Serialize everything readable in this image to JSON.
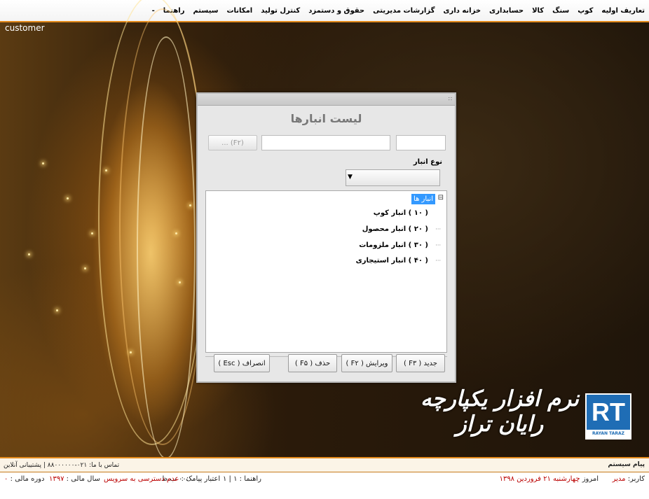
{
  "menubar": {
    "items": [
      "تعاریف اولیه",
      "کوپ",
      "سنگ",
      "کالا",
      "حسابداری",
      "خزانه داری",
      "گزارشات مدیریتی",
      "حقوق و دستمزد",
      "کنترل تولید",
      "امکانات",
      "سیستم",
      "راهنما",
      "-"
    ]
  },
  "desktop": {
    "label": "customer",
    "brand_text": "نرم افزار یکپارچه رایان تراز",
    "logo_mark": "RT",
    "logo_caption": "RAYAN TARAZ"
  },
  "dialog": {
    "title": "لیست انبارها",
    "search_placeholder_left": "",
    "search_placeholder_right": "",
    "f2_button": "(F۲) ...",
    "type_label": "نوع انبار",
    "type_value": "",
    "tree": {
      "root": "انبار ها",
      "items": [
        "( ۱۰ ) انبار کوپ",
        "( ۲۰ ) انبار محصول",
        "( ۳۰ ) انبار ملزومات",
        "( ۴۰ ) انبار استیجاری"
      ]
    },
    "buttons": {
      "new": "جدید ( F۳ )",
      "edit": "ویرایش ( F۲ )",
      "delete": "حذف ( F۵ )",
      "cancel": "انصراف ( Esc )"
    }
  },
  "status": {
    "line1_left": "تماس با ما: ۰۲۱-۸۸۰۰۰۰۰۰  |  پشتیبانی آنلاین",
    "line1_right": "پیام سیستم",
    "user_label": "کاربر:",
    "user_value": "مدیر",
    "today_label": "امروز",
    "today_value": "چهارشنبه ۲۱ فروردین ۱۳۹۸",
    "time_value": "۰۰:۰۰ ب.ظ",
    "help_label": "راهنما :",
    "help_value": "۱ | ۱",
    "sms_label": "اعتبار پیامک :",
    "sms_value": "عدم دسترسی به سرویس",
    "fiscal_label": "سال مالی :",
    "fiscal_value": "۱۳۹۷",
    "period_label": "دوره مالی :",
    "period_value": "۰"
  }
}
